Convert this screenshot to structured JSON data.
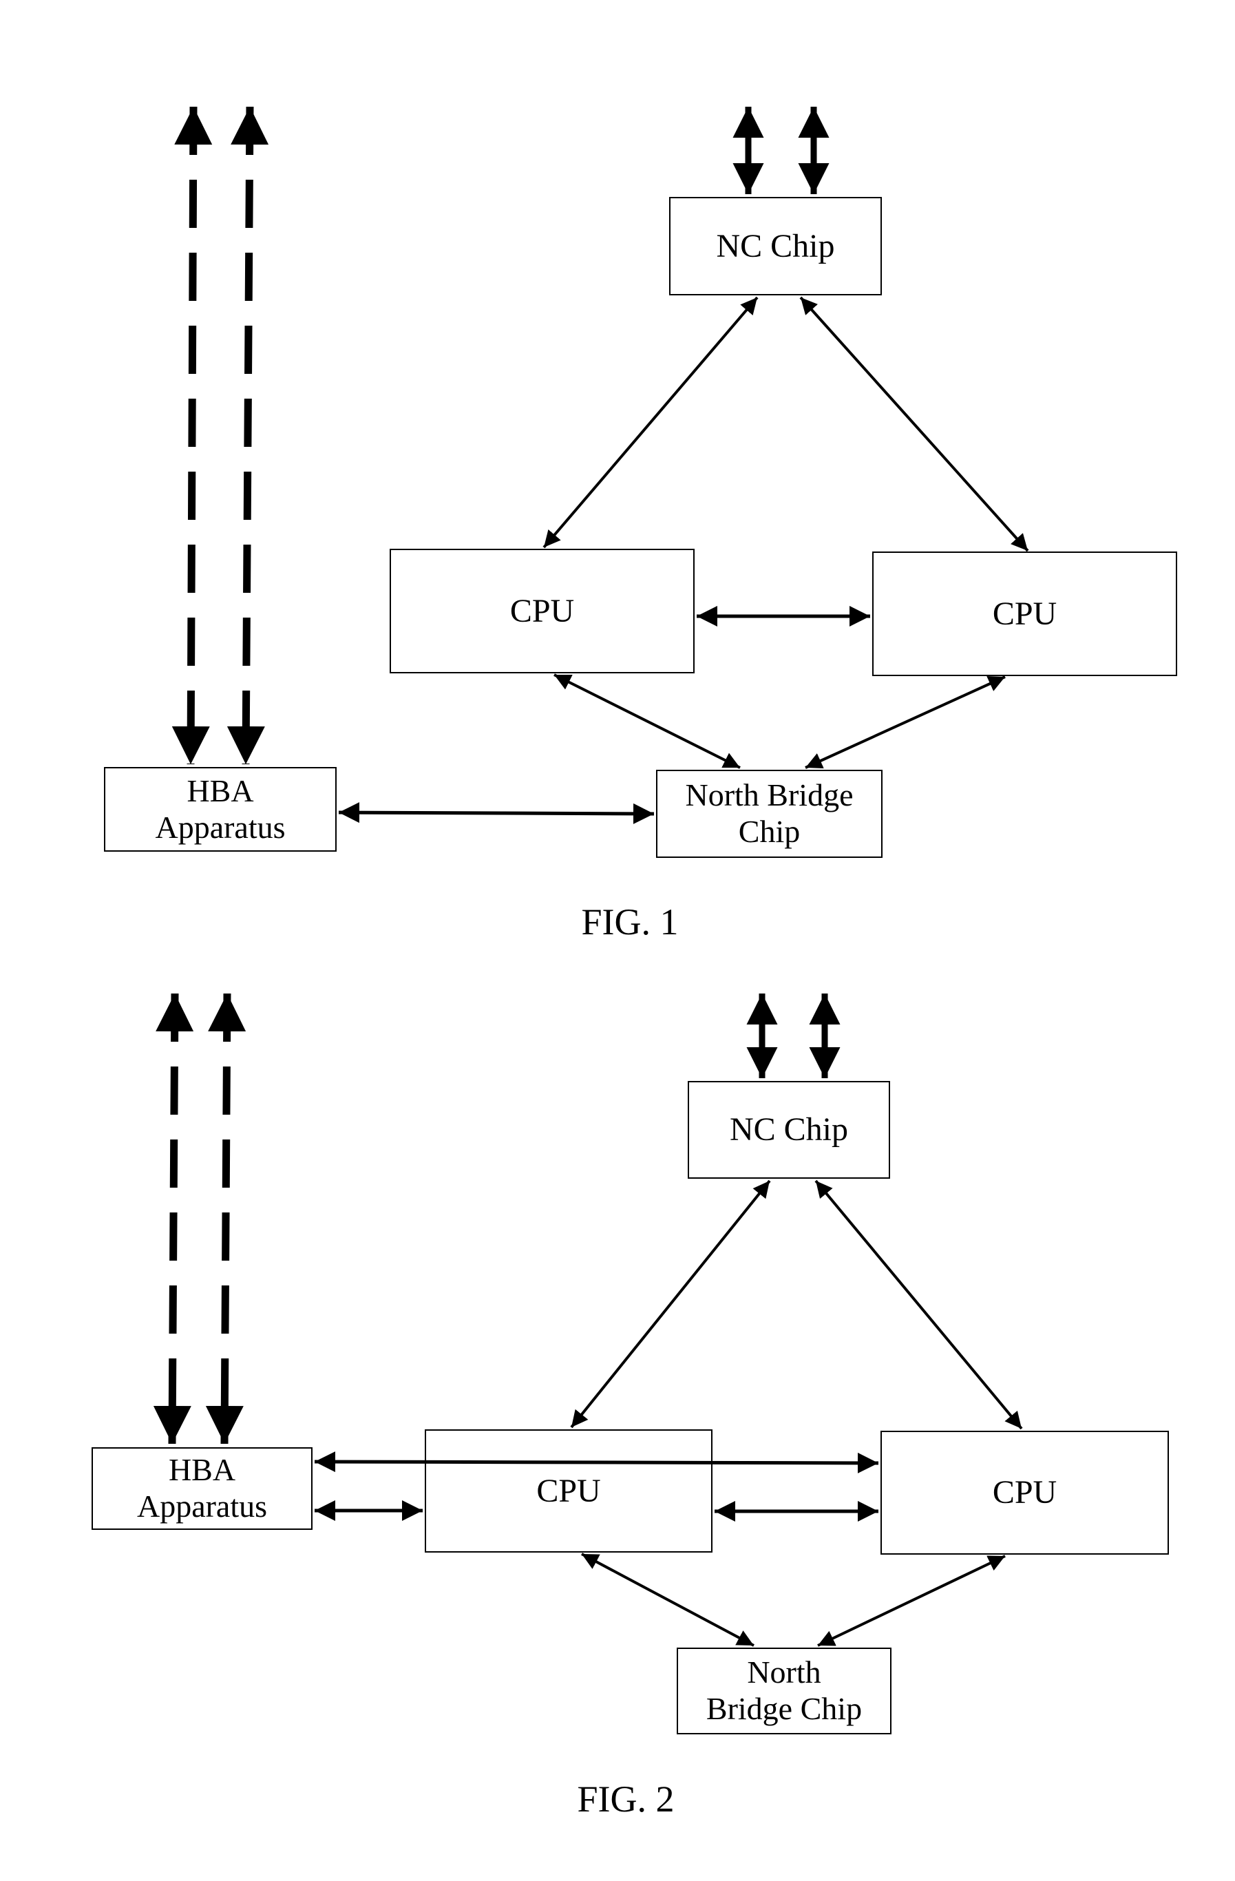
{
  "figures": [
    {
      "id": "fig1",
      "caption": "FIG. 1",
      "nodes": {
        "nc_chip": {
          "label": "NC Chip"
        },
        "cpu_left": {
          "label": "CPU"
        },
        "cpu_right": {
          "label": "CPU"
        },
        "hba": {
          "label_line1": "HBA",
          "label_line2": "Apparatus"
        },
        "north_bridge": {
          "label_line1": "North Bridge",
          "label_line2": "Chip"
        }
      },
      "connections": [
        {
          "from": "nc_chip",
          "to": "cpu_left",
          "type": "bidirectional"
        },
        {
          "from": "nc_chip",
          "to": "cpu_right",
          "type": "bidirectional"
        },
        {
          "from": "cpu_left",
          "to": "cpu_right",
          "type": "bidirectional"
        },
        {
          "from": "cpu_left",
          "to": "north_bridge",
          "type": "bidirectional"
        },
        {
          "from": "cpu_right",
          "to": "north_bridge",
          "type": "bidirectional"
        },
        {
          "from": "hba",
          "to": "north_bridge",
          "type": "bidirectional"
        },
        {
          "from": "nc_chip",
          "to": "external",
          "type": "bidirectional-bold",
          "count": 2
        },
        {
          "from": "hba",
          "to": "external",
          "type": "bidirectional-dashed",
          "count": 2
        }
      ]
    },
    {
      "id": "fig2",
      "caption": "FIG. 2",
      "nodes": {
        "nc_chip": {
          "label": "NC Chip"
        },
        "cpu_left": {
          "label": "CPU"
        },
        "cpu_right": {
          "label": "CPU"
        },
        "hba": {
          "label_line1": "HBA",
          "label_line2": "Apparatus"
        },
        "north_bridge": {
          "label_line1": "North",
          "label_line2": "Bridge Chip"
        }
      },
      "connections": [
        {
          "from": "nc_chip",
          "to": "cpu_left",
          "type": "bidirectional"
        },
        {
          "from": "nc_chip",
          "to": "cpu_right",
          "type": "bidirectional"
        },
        {
          "from": "cpu_left",
          "to": "cpu_right",
          "type": "bidirectional"
        },
        {
          "from": "cpu_left",
          "to": "north_bridge",
          "type": "bidirectional"
        },
        {
          "from": "cpu_right",
          "to": "north_bridge",
          "type": "bidirectional"
        },
        {
          "from": "hba",
          "to": "cpu_left",
          "type": "bidirectional"
        },
        {
          "from": "hba",
          "to": "cpu_right",
          "type": "bidirectional"
        },
        {
          "from": "nc_chip",
          "to": "external",
          "type": "bidirectional-bold",
          "count": 2
        },
        {
          "from": "hba",
          "to": "external",
          "type": "bidirectional-dashed",
          "count": 2
        }
      ]
    }
  ]
}
